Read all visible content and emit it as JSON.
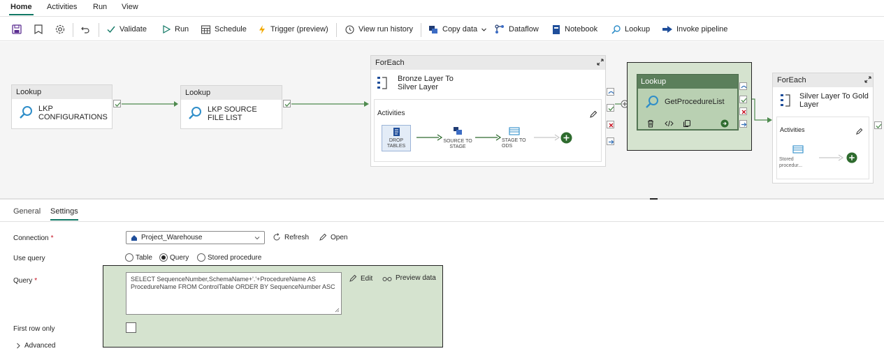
{
  "top_tabs": [
    "Home",
    "Activities",
    "Run",
    "View"
  ],
  "toolbar": {
    "validate": "Validate",
    "run": "Run",
    "schedule": "Schedule",
    "trigger": "Trigger (preview)",
    "view_run_history": "View run history",
    "copy_data": "Copy data",
    "dataflow": "Dataflow",
    "notebook": "Notebook",
    "lookup": "Lookup",
    "invoke_pipeline": "Invoke pipeline"
  },
  "canvas": {
    "lookup1": {
      "type": "Lookup",
      "title": "LKP CONFIGURATIONS"
    },
    "lookup2": {
      "type": "Lookup",
      "title": "LKP SOURCE FILE LIST"
    },
    "foreach1": {
      "type": "ForEach",
      "title": "Bronze Layer To Silver Layer",
      "activities_label": "Activities",
      "steps": [
        "DROP TABLES",
        "SOURCE TO STAGE",
        "STAGE TO ODS"
      ]
    },
    "lookup3": {
      "type": "Lookup",
      "title": "GetProcedureList"
    },
    "foreach2": {
      "type": "ForEach",
      "title": "Silver Layer To Gold Layer",
      "activities_label": "Activities",
      "steps": [
        "Stored procedur..."
      ]
    }
  },
  "panel": {
    "tabs": [
      "General",
      "Settings"
    ],
    "connection_label": "Connection",
    "connection_value": "Project_Warehouse",
    "refresh": "Refresh",
    "open": "Open",
    "use_query_label": "Use query",
    "use_query_options": [
      "Table",
      "Query",
      "Stored procedure"
    ],
    "use_query_selected": "Query",
    "query_label": "Query",
    "query_text": "SELECT SequenceNumber,SchemaName+'.'+ProcedureName AS ProcedureName FROM ControlTable ORDER BY SequenceNumber ASC",
    "edit": "Edit",
    "preview_data": "Preview data",
    "first_row_only_label": "First row only",
    "advanced_label": "Advanced"
  },
  "colors": {
    "accent": "#117865",
    "selected_node": "#5b7f5b",
    "highlight": "#d5e3cf",
    "required": "#c50f1f"
  }
}
